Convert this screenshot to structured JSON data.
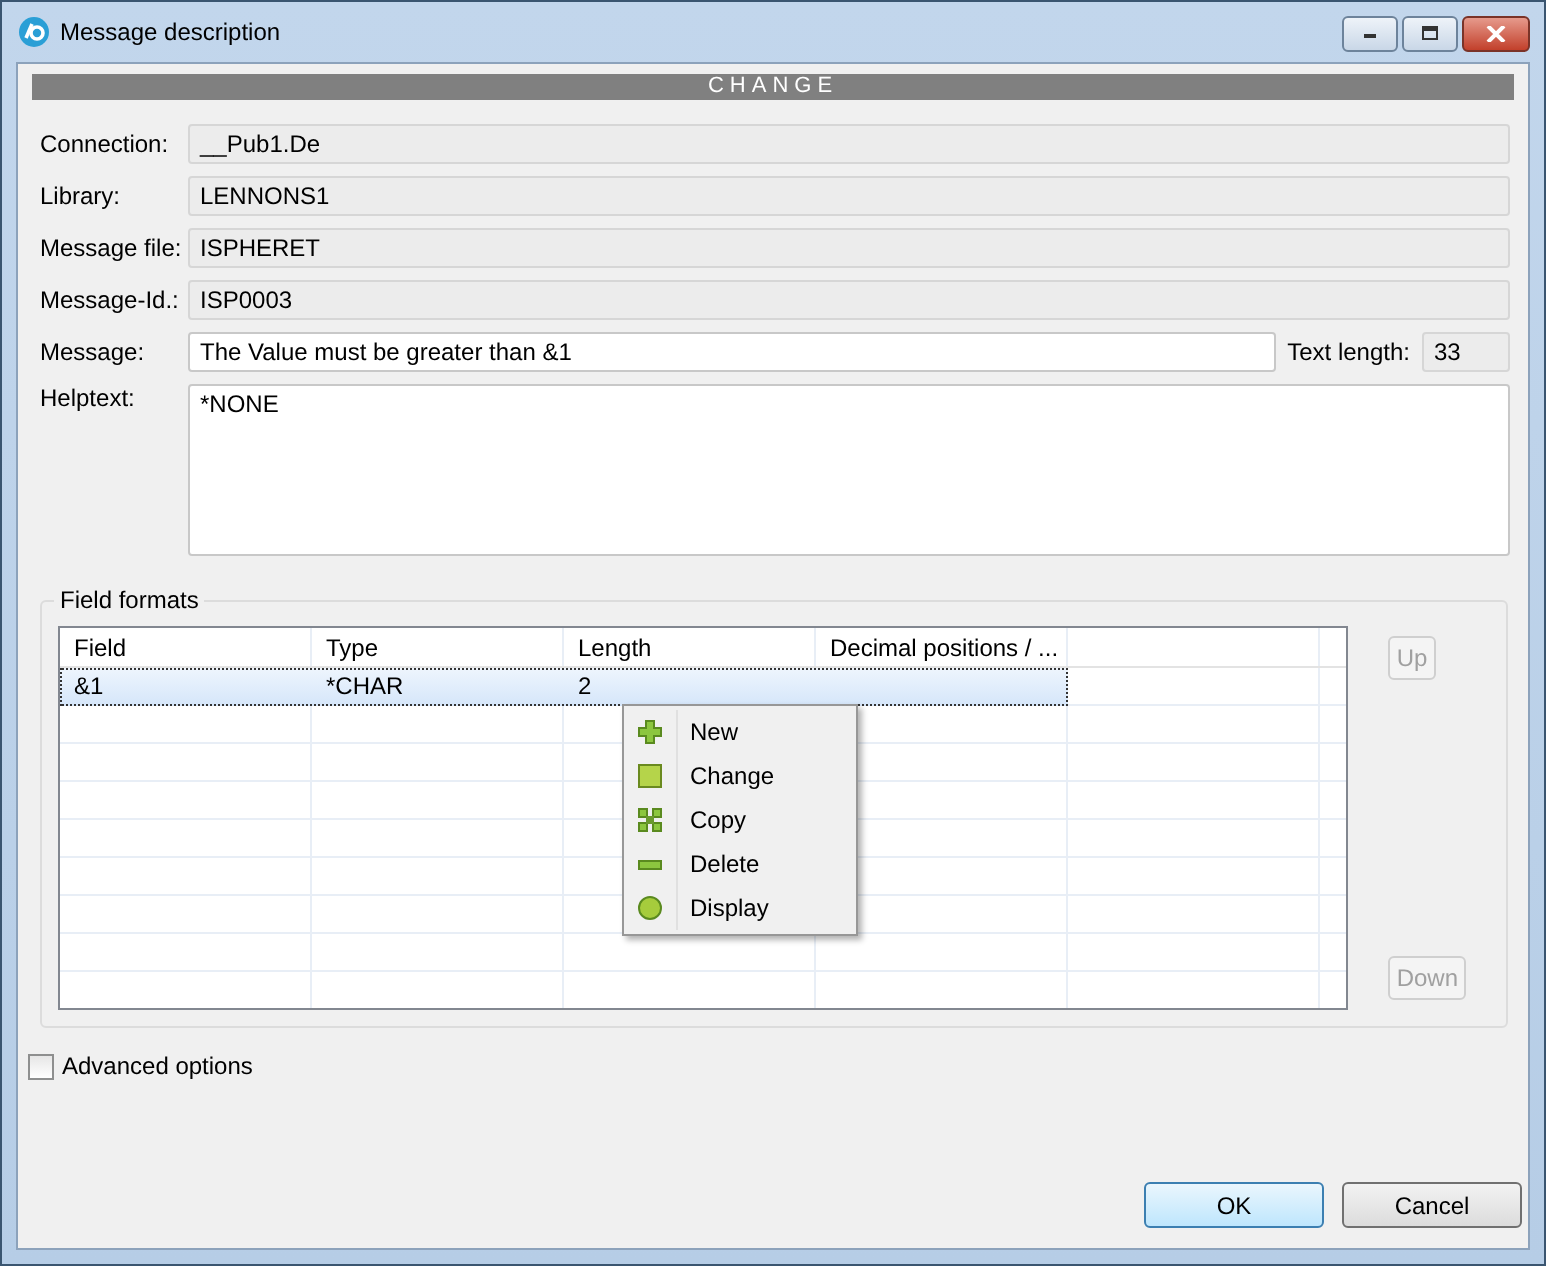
{
  "window": {
    "title": "Message description"
  },
  "banner": "CHANGE",
  "fields": [
    {
      "label": "Connection:",
      "value": "__Pub1.De",
      "readonly": true
    },
    {
      "label": "Library:",
      "value": "LENNONS1",
      "readonly": true
    },
    {
      "label": "Message file:",
      "value": "ISPHERET",
      "readonly": true
    },
    {
      "label": "Message-Id.:",
      "value": "ISP0003",
      "readonly": true
    }
  ],
  "message": {
    "label": "Message:",
    "value": "The Value must be greater than &1",
    "readonly": false,
    "length_label": "Text length:",
    "length_value": "33"
  },
  "helptext": {
    "label": "Helptext:",
    "value": "*NONE"
  },
  "field_formats": {
    "title": "Field formats",
    "columns": [
      "Field",
      "Type",
      "Length",
      "Decimal positions / ..."
    ],
    "rows": [
      {
        "cells": [
          "&1",
          "*CHAR",
          "2"
        ],
        "selected": true
      }
    ],
    "buttons": [
      {
        "label": "Up",
        "disabled": true
      },
      {
        "label": "Down",
        "disabled": true
      }
    ]
  },
  "context_menu": [
    {
      "label": "New",
      "kind": "new"
    },
    {
      "label": "Change",
      "kind": "change"
    },
    {
      "label": "Copy",
      "kind": "copy"
    },
    {
      "label": "Delete",
      "kind": "delete"
    },
    {
      "label": "Display",
      "kind": "display"
    }
  ],
  "advanced_options": {
    "label": "Advanced options",
    "checked": false
  },
  "buttons": [
    {
      "label": "OK",
      "default": true
    },
    {
      "label": "Cancel",
      "default": false
    }
  ]
}
